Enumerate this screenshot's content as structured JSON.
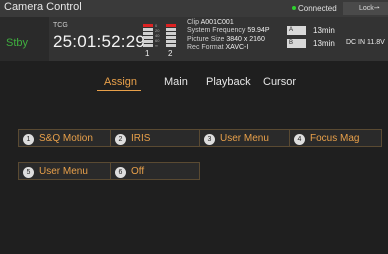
{
  "titlebar": {
    "title": "Camera Control",
    "connection": "Connected",
    "lock_label": "Lock"
  },
  "status": {
    "mode": "Stby",
    "tc_label": "TCG",
    "timecode": "25:01:52:29",
    "meter_channels": [
      "1",
      "2"
    ],
    "meter_scale": [
      "0",
      "20",
      "40",
      "60",
      "∞"
    ],
    "clip_label": "Clip",
    "clip_value": "A001C001",
    "sysfreq_label": "System Frequency",
    "sysfreq_value": "59.94P",
    "picsize_label": "Picture Size",
    "picsize_value": "3840 x 2160",
    "recfmt_label": "Rec Format",
    "recfmt_value": "XAVC-I",
    "media": [
      {
        "slot": "A",
        "time": "13min"
      },
      {
        "slot": "B",
        "time": "13min"
      }
    ],
    "power": "DC IN 11.8V"
  },
  "tabs": [
    "Assign",
    "Main",
    "Playback",
    "Cursor"
  ],
  "active_tab": "Assign",
  "assign_buttons": [
    {
      "num": "1",
      "label": "S&Q Motion"
    },
    {
      "num": "2",
      "label": "IRIS"
    },
    {
      "num": "3",
      "label": "User Menu"
    },
    {
      "num": "4",
      "label": "Focus Mag"
    },
    {
      "num": "5",
      "label": "User Menu"
    },
    {
      "num": "6",
      "label": "Off"
    }
  ],
  "colors": {
    "accent": "#e8a04a",
    "status_green": "#3fae3f",
    "connected_dot": "#2fd12f",
    "meter_red": "#d22",
    "meter_white": "#d0d0d0"
  }
}
